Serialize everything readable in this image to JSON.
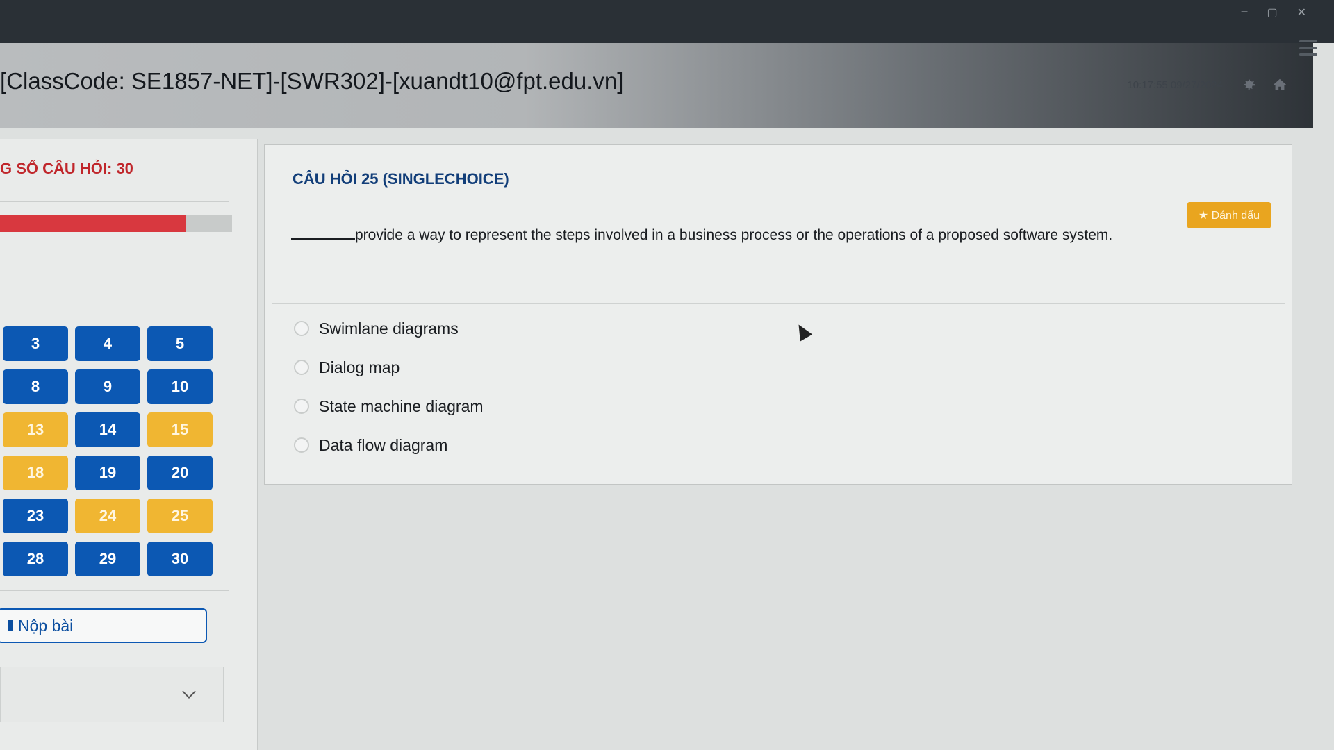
{
  "window": {
    "controls": [
      "–",
      "▢",
      "✕"
    ]
  },
  "header": {
    "title": "[ClassCode: SE1857-NET]-[SWR302]-[xuandt10@fpt.edu.vn]",
    "datetime": "10:17:55 09/27/2024",
    "icons": [
      "gear-icon",
      "home-icon",
      "menu-icon"
    ]
  },
  "sidebar": {
    "total_label": "G SỐ CÂU HỎI: 30",
    "progress": 0.8,
    "questions": [
      {
        "n": "3",
        "state": "answered"
      },
      {
        "n": "4",
        "state": "answered"
      },
      {
        "n": "5",
        "state": "answered"
      },
      {
        "n": "8",
        "state": "answered"
      },
      {
        "n": "9",
        "state": "answered"
      },
      {
        "n": "10",
        "state": "answered"
      },
      {
        "n": "13",
        "state": "marked"
      },
      {
        "n": "14",
        "state": "answered"
      },
      {
        "n": "15",
        "state": "marked"
      },
      {
        "n": "18",
        "state": "marked"
      },
      {
        "n": "19",
        "state": "answered"
      },
      {
        "n": "20",
        "state": "answered"
      },
      {
        "n": "23",
        "state": "answered"
      },
      {
        "n": "24",
        "state": "marked"
      },
      {
        "n": "25",
        "state": "marked"
      },
      {
        "n": "28",
        "state": "answered"
      },
      {
        "n": "29",
        "state": "answered"
      },
      {
        "n": "30",
        "state": "answered"
      }
    ],
    "submit_label": "Nộp bài"
  },
  "question": {
    "title": "CÂU HỎI 25 (SINGLECHOICE)",
    "mark_label": "★ Đánh dấu",
    "text": "provide a way to represent the steps involved in a business process or the operations of a proposed software system.",
    "options": [
      "Swimlane diagrams",
      "Dialog map",
      "State machine diagram",
      "Data flow diagram"
    ]
  },
  "colors": {
    "answered": "#0c58b3",
    "marked": "#f0b632",
    "accent_red": "#c0262b"
  }
}
